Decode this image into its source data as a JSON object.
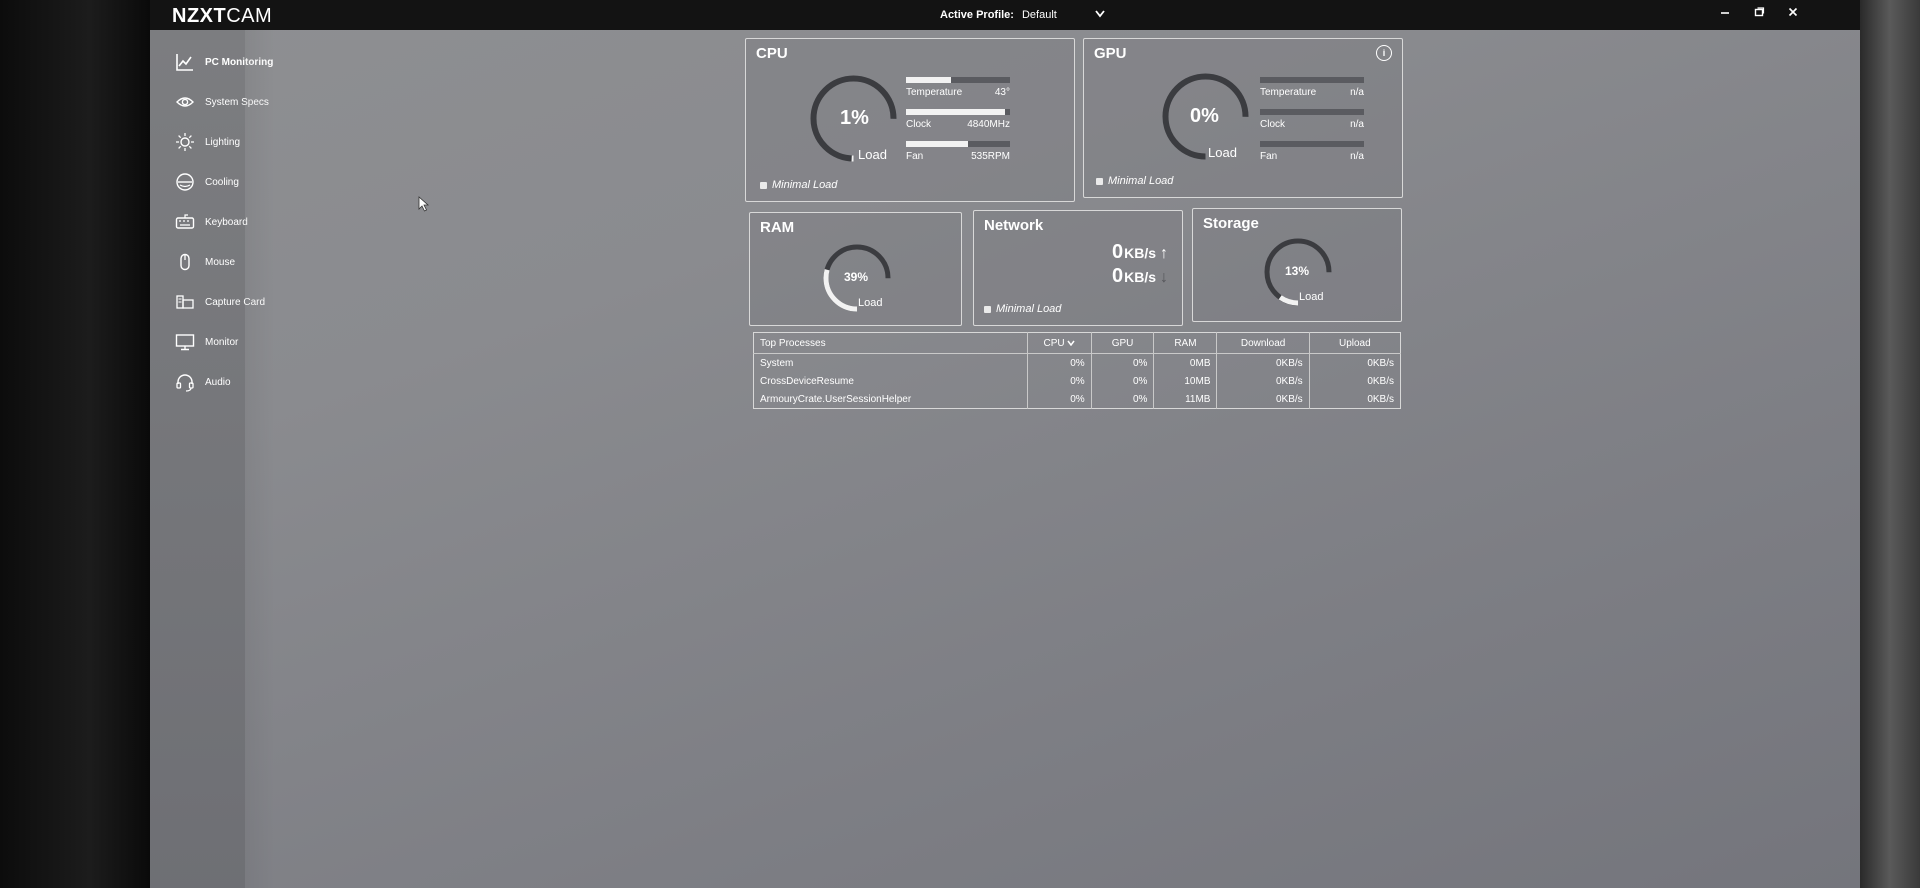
{
  "app": {
    "logo_bold": "NZXT",
    "logo_light": "CAM",
    "active_profile_label": "Active Profile:",
    "active_profile_value": "Default"
  },
  "sidebar": {
    "items": [
      {
        "label": "PC Monitoring",
        "icon": "chart-icon",
        "active": true
      },
      {
        "label": "System Specs",
        "icon": "eye-icon"
      },
      {
        "label": "Lighting",
        "icon": "sun-icon"
      },
      {
        "label": "Cooling",
        "icon": "cooling-icon"
      },
      {
        "label": "Keyboard",
        "icon": "keyboard-icon"
      },
      {
        "label": "Mouse",
        "icon": "mouse-icon"
      },
      {
        "label": "Capture Card",
        "icon": "capture-card-icon"
      },
      {
        "label": "Monitor",
        "icon": "monitor-icon"
      },
      {
        "label": "Audio",
        "icon": "headset-icon"
      }
    ]
  },
  "cpu": {
    "title": "CPU",
    "load_value": "1%",
    "load_fraction": 0.01,
    "load_label": "Load",
    "metrics": [
      {
        "label": "Temperature",
        "value": "43°",
        "fill": 0.43
      },
      {
        "label": "Clock",
        "value": "4840MHz",
        "fill": 0.95
      },
      {
        "label": "Fan",
        "value": "535RPM",
        "fill": 0.6
      }
    ],
    "status": "Minimal Load"
  },
  "gpu": {
    "title": "GPU",
    "load_value": "0%",
    "load_fraction": 0,
    "load_label": "Load",
    "metrics": [
      {
        "label": "Temperature",
        "value": "n/a",
        "fill": 0
      },
      {
        "label": "Clock",
        "value": "n/a",
        "fill": 0
      },
      {
        "label": "Fan",
        "value": "n/a",
        "fill": 0
      }
    ],
    "status": "Minimal Load"
  },
  "ram": {
    "title": "RAM",
    "load_value": "39%",
    "load_fraction": 0.39,
    "load_label": "Load"
  },
  "network": {
    "title": "Network",
    "upload_value": "0",
    "upload_unit": "KB/s",
    "download_value": "0",
    "download_unit": "KB/s",
    "status": "Minimal Load"
  },
  "storage": {
    "title": "Storage",
    "load_value": "13%",
    "load_fraction": 0.13,
    "load_label": "Load"
  },
  "processes": {
    "headers": [
      "Top Processes",
      "CPU",
      "GPU",
      "RAM",
      "Download",
      "Upload"
    ],
    "sort_icon": "chevron-down-icon",
    "rows": [
      [
        "System",
        "0%",
        "0%",
        "0MB",
        "0KB/s",
        "0KB/s"
      ],
      [
        "CrossDeviceResume",
        "0%",
        "0%",
        "10MB",
        "0KB/s",
        "0KB/s"
      ],
      [
        "ArmouryCrate.UserSessionHelper",
        "0%",
        "0%",
        "11MB",
        "0KB/s",
        "0KB/s"
      ]
    ]
  }
}
